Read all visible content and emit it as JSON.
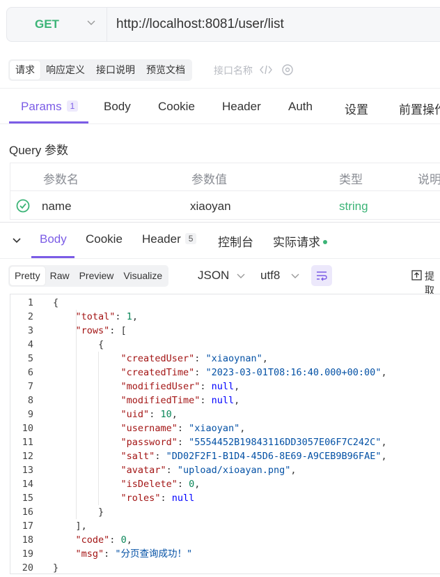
{
  "request": {
    "method": "GET",
    "url": "http://localhost:8081/user/list"
  },
  "subtabs": [
    "请求",
    "响应定义",
    "接口说明",
    "预览文档"
  ],
  "api_name_placeholder": "接口名称",
  "request_tabs": {
    "params": "Params",
    "params_count": "1",
    "body": "Body",
    "cookie": "Cookie",
    "header": "Header",
    "auth": "Auth",
    "settings": "设置",
    "pre_ops": "前置操作"
  },
  "query": {
    "title": "Query 参数",
    "headers": [
      "参数名",
      "参数值",
      "类型",
      "说明"
    ],
    "rows": [
      {
        "name": "name",
        "value": "xiaoyan",
        "type": "string"
      }
    ]
  },
  "response_tabs": {
    "body": "Body",
    "cookie": "Cookie",
    "header": "Header",
    "header_count": "5",
    "console": "控制台",
    "actual_request": "实际请求"
  },
  "response_toolbar": {
    "views": [
      "Pretty",
      "Raw",
      "Preview",
      "Visualize"
    ],
    "format": "JSON",
    "encoding": "utf8",
    "extract": "提取"
  },
  "code_lines": [
    [
      {
        "t": "{",
        "c": ""
      }
    ],
    [
      {
        "t": "    ",
        "c": ""
      },
      {
        "t": "\"total\"",
        "c": "k"
      },
      {
        "t": ": ",
        "c": ""
      },
      {
        "t": "1",
        "c": "n"
      },
      {
        "t": ",",
        "c": ""
      }
    ],
    [
      {
        "t": "    ",
        "c": ""
      },
      {
        "t": "\"rows\"",
        "c": "k"
      },
      {
        "t": ": [",
        "c": ""
      }
    ],
    [
      {
        "t": "        {",
        "c": ""
      }
    ],
    [
      {
        "t": "            ",
        "c": ""
      },
      {
        "t": "\"createdUser\"",
        "c": "k"
      },
      {
        "t": ": ",
        "c": ""
      },
      {
        "t": "\"xiaoynan\"",
        "c": "s"
      },
      {
        "t": ",",
        "c": ""
      }
    ],
    [
      {
        "t": "            ",
        "c": ""
      },
      {
        "t": "\"createdTime\"",
        "c": "k"
      },
      {
        "t": ": ",
        "c": ""
      },
      {
        "t": "\"2023-03-01T08:16:40.000+00:00\"",
        "c": "s"
      },
      {
        "t": ",",
        "c": ""
      }
    ],
    [
      {
        "t": "            ",
        "c": ""
      },
      {
        "t": "\"modifiedUser\"",
        "c": "k"
      },
      {
        "t": ": ",
        "c": ""
      },
      {
        "t": "null",
        "c": "kw"
      },
      {
        "t": ",",
        "c": ""
      }
    ],
    [
      {
        "t": "            ",
        "c": ""
      },
      {
        "t": "\"modifiedTime\"",
        "c": "k"
      },
      {
        "t": ": ",
        "c": ""
      },
      {
        "t": "null",
        "c": "kw"
      },
      {
        "t": ",",
        "c": ""
      }
    ],
    [
      {
        "t": "            ",
        "c": ""
      },
      {
        "t": "\"uid\"",
        "c": "k"
      },
      {
        "t": ": ",
        "c": ""
      },
      {
        "t": "10",
        "c": "n"
      },
      {
        "t": ",",
        "c": ""
      }
    ],
    [
      {
        "t": "            ",
        "c": ""
      },
      {
        "t": "\"username\"",
        "c": "k"
      },
      {
        "t": ": ",
        "c": ""
      },
      {
        "t": "\"xiaoyan\"",
        "c": "s"
      },
      {
        "t": ",",
        "c": ""
      }
    ],
    [
      {
        "t": "            ",
        "c": ""
      },
      {
        "t": "\"password\"",
        "c": "k"
      },
      {
        "t": ": ",
        "c": ""
      },
      {
        "t": "\"5554452B19843116DD3057E06F7C242C\"",
        "c": "s"
      },
      {
        "t": ",",
        "c": ""
      }
    ],
    [
      {
        "t": "            ",
        "c": ""
      },
      {
        "t": "\"salt\"",
        "c": "k"
      },
      {
        "t": ": ",
        "c": ""
      },
      {
        "t": "\"DD02F2F1-B1D4-45D6-8E69-A9CEB9B96FAE\"",
        "c": "s"
      },
      {
        "t": ",",
        "c": ""
      }
    ],
    [
      {
        "t": "            ",
        "c": ""
      },
      {
        "t": "\"avatar\"",
        "c": "k"
      },
      {
        "t": ": ",
        "c": ""
      },
      {
        "t": "\"upload/xioayan.png\"",
        "c": "s"
      },
      {
        "t": ",",
        "c": ""
      }
    ],
    [
      {
        "t": "            ",
        "c": ""
      },
      {
        "t": "\"isDelete\"",
        "c": "k"
      },
      {
        "t": ": ",
        "c": ""
      },
      {
        "t": "0",
        "c": "n"
      },
      {
        "t": ",",
        "c": ""
      }
    ],
    [
      {
        "t": "            ",
        "c": ""
      },
      {
        "t": "\"roles\"",
        "c": "k"
      },
      {
        "t": ": ",
        "c": ""
      },
      {
        "t": "null",
        "c": "kw"
      }
    ],
    [
      {
        "t": "        }",
        "c": ""
      }
    ],
    [
      {
        "t": "    ],",
        "c": ""
      }
    ],
    [
      {
        "t": "    ",
        "c": ""
      },
      {
        "t": "\"code\"",
        "c": "k"
      },
      {
        "t": ": ",
        "c": ""
      },
      {
        "t": "0",
        "c": "n"
      },
      {
        "t": ",",
        "c": ""
      }
    ],
    [
      {
        "t": "    ",
        "c": ""
      },
      {
        "t": "\"msg\"",
        "c": "k"
      },
      {
        "t": ": ",
        "c": ""
      },
      {
        "t": "\"分页查询成功！\"",
        "c": "s"
      }
    ],
    [
      {
        "t": "}",
        "c": ""
      }
    ]
  ],
  "colors": {
    "accent": "#7b5ce6",
    "method_get": "#3cb477",
    "json_key": "#a31515",
    "json_string": "#0451a5",
    "json_number": "#098658",
    "json_null": "#0000ff"
  }
}
